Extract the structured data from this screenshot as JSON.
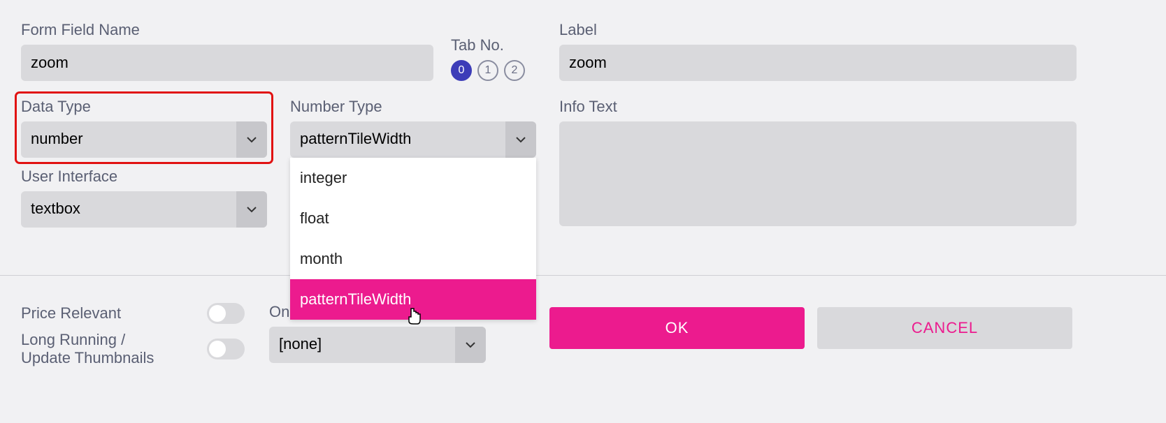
{
  "form": {
    "field_name": {
      "label": "Form Field Name",
      "value": "zoom"
    },
    "tab_no": {
      "label": "Tab No.",
      "options": [
        "0",
        "1",
        "2"
      ],
      "active_index": 0
    },
    "label_field": {
      "label": "Label",
      "value": "zoom"
    },
    "data_type": {
      "label": "Data Type",
      "value": "number"
    },
    "number_type": {
      "label": "Number Type",
      "value": "patternTileWidth",
      "options": [
        "integer",
        "float",
        "month",
        "patternTileWidth"
      ],
      "selected_index": 3
    },
    "info_text": {
      "label": "Info Text",
      "value": ""
    },
    "user_interface": {
      "label": "User Interface",
      "value": "textbox"
    }
  },
  "footer": {
    "price_relevant_label": "Price Relevant",
    "long_running_label_line1": "Long Running /",
    "long_running_label_line2": "Update Thumbnails",
    "on_change_label_prefix": "On",
    "on_change_value": "[none]",
    "price_relevant_on": false,
    "long_running_on": false
  },
  "buttons": {
    "ok": "OK",
    "cancel": "CANCEL"
  },
  "colors": {
    "accent_pink": "#ec1b8e",
    "accent_purple": "#3d3db8",
    "highlight_red": "#e11212"
  }
}
